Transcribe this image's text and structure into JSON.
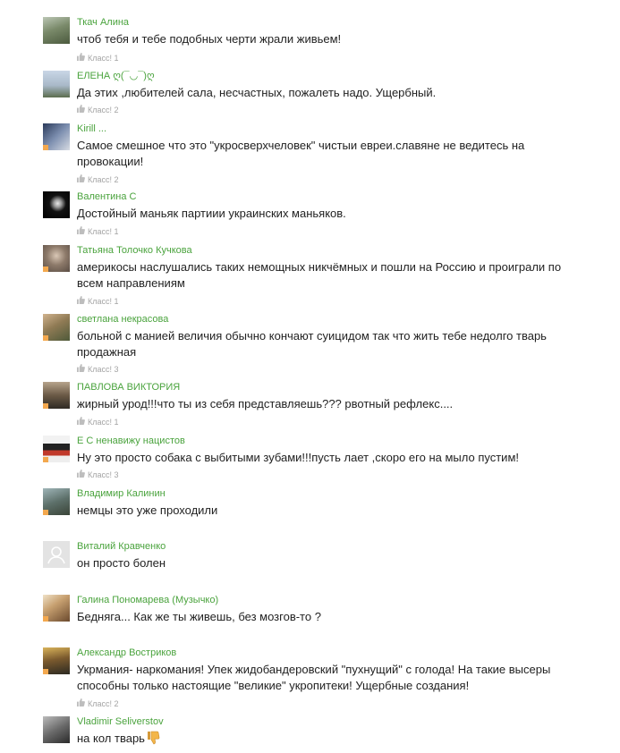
{
  "like_label": "Класс!",
  "comments": [
    {
      "author": "Ткач Алина",
      "text": "чтоб тебя и тебе подобных черти жрали живьем!",
      "likes": "1"
    },
    {
      "author": "ЕЛЕНА ღ(¯◡¯)ღ",
      "text": "Да этих ,любителей сала, несчастных, пожалеть надо. Ущербный.",
      "likes": "2"
    },
    {
      "author": "Kirill ...",
      "text": "Самое смешное что это \"укросверхчеловек\" чистыи евреи.славяне не ведитесь на провокации!",
      "likes": "2"
    },
    {
      "author": "Валентина С",
      "text": "Достойный маньяк партиии украинских маньяков.",
      "likes": "1"
    },
    {
      "author": "Татьяна Толочко Кучкова",
      "text": "америкосы наслушались таких немощных никчёмных и пошли на Россию и проиграли по всем направлениям",
      "likes": "1"
    },
    {
      "author": "светлана некрасова",
      "text": "больной с манией величия обычно кончают суицидом так что жить тебе недолго тварь продажная",
      "likes": "3"
    },
    {
      "author": "ПАВЛОВА ВИКТОРИЯ",
      "text": "жирный урод!!!что ты из себя представляешь??? рвотный рефлекс....",
      "likes": "1"
    },
    {
      "author": "Е С ненавижу нацистов",
      "text": "Ну это просто собака с выбитыми зубами!!!пусть лает ,скоро его на мыло пустим!",
      "likes": "3"
    },
    {
      "author": "Владимир Калинин",
      "text": "немцы это уже проходили",
      "likes": ""
    },
    {
      "author": "Виталий Кравченко",
      "text": "он  просто  болен",
      "likes": ""
    },
    {
      "author": "Галина Пономарева (Музычко)",
      "text": "Бедняга... Как же ты живешь, без мозгов-то ?",
      "likes": ""
    },
    {
      "author": "Александр Востриков",
      "text": "Укрмания- наркомания! Упек жидобандеровский \"пухнущий\"  с голода! На такие высеры способны только настоящие \"великие\" укропитеки! Ущербные создания!",
      "likes": "2"
    },
    {
      "author": "Vladimir Seliverstov",
      "text": "на кол тварь",
      "likes": "",
      "emoji": "thumbs-down"
    }
  ],
  "colors": {
    "author": "#4aa33d",
    "text": "#222222",
    "meta": "#a3a3a3",
    "online_dot": "#f3a84e"
  }
}
